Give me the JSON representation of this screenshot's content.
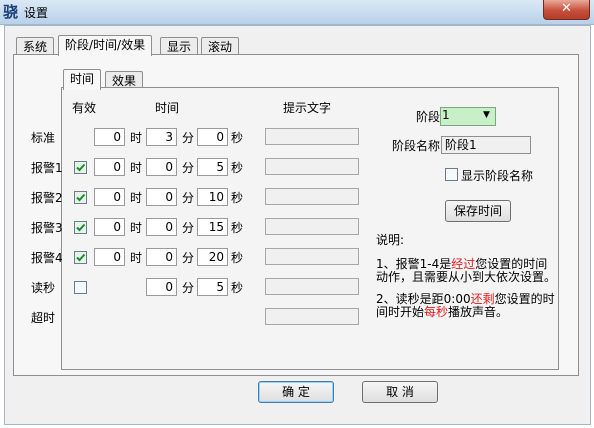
{
  "window": {
    "title": "设置",
    "app_icon": "骁",
    "close_glyph": "✕"
  },
  "top_tabs": [
    {
      "label": "系统",
      "active": false
    },
    {
      "label": "阶段/时间/效果",
      "active": true
    },
    {
      "label": "显示",
      "active": false
    },
    {
      "label": "滚动",
      "active": false
    }
  ],
  "sub_tabs": [
    {
      "label": "时间",
      "active": true
    },
    {
      "label": "效果",
      "active": false
    }
  ],
  "headers": {
    "enabled": "有效",
    "time": "时间",
    "hint": "提示文字"
  },
  "units": {
    "hour": "时",
    "minute": "分",
    "second": "秒"
  },
  "rows": [
    {
      "label": "标准",
      "has_checkbox": false,
      "checked": false,
      "hour": "0",
      "minute": "3",
      "second": "0"
    },
    {
      "label": "报警1",
      "has_checkbox": true,
      "checked": true,
      "hour": "0",
      "minute": "0",
      "second": "5"
    },
    {
      "label": "报警2",
      "has_checkbox": true,
      "checked": true,
      "hour": "0",
      "minute": "0",
      "second": "10"
    },
    {
      "label": "报警3",
      "has_checkbox": true,
      "checked": true,
      "hour": "0",
      "minute": "0",
      "second": "15"
    },
    {
      "label": "报警4",
      "has_checkbox": true,
      "checked": true,
      "hour": "0",
      "minute": "0",
      "second": "20"
    },
    {
      "label": "读秒",
      "has_checkbox": true,
      "checked": false,
      "hour": null,
      "minute": "0",
      "second": "5"
    },
    {
      "label": "超时",
      "has_checkbox": false,
      "checked": false,
      "hour": null,
      "minute": null,
      "second": null
    }
  ],
  "stage": {
    "label": "阶段",
    "value": "1"
  },
  "stage_name": {
    "label": "阶段名称",
    "value": "阶段1"
  },
  "show_stage_name": {
    "label": "显示阶段名称",
    "checked": false
  },
  "save_time_label": "保存时间",
  "notes": {
    "title": "说明:",
    "n1_a": "1、报警1-4是",
    "n1_red": "经过",
    "n1_b": "您设置的时间",
    "n1_c": "动作，且需要从小到大依次设置。",
    "n2_a": "2、读秒是距0:00",
    "n2_red1": "还剩",
    "n2_b": "您设置的时",
    "n2_c": "间时开始",
    "n2_red2": "每秒",
    "n2_d": "播放声音。"
  },
  "buttons": {
    "ok": "确 定",
    "cancel": "取 消"
  },
  "colors": {
    "highlight_red": "#e02020",
    "select_bg": "#c8f0c8",
    "close_red": "#c7503c"
  }
}
